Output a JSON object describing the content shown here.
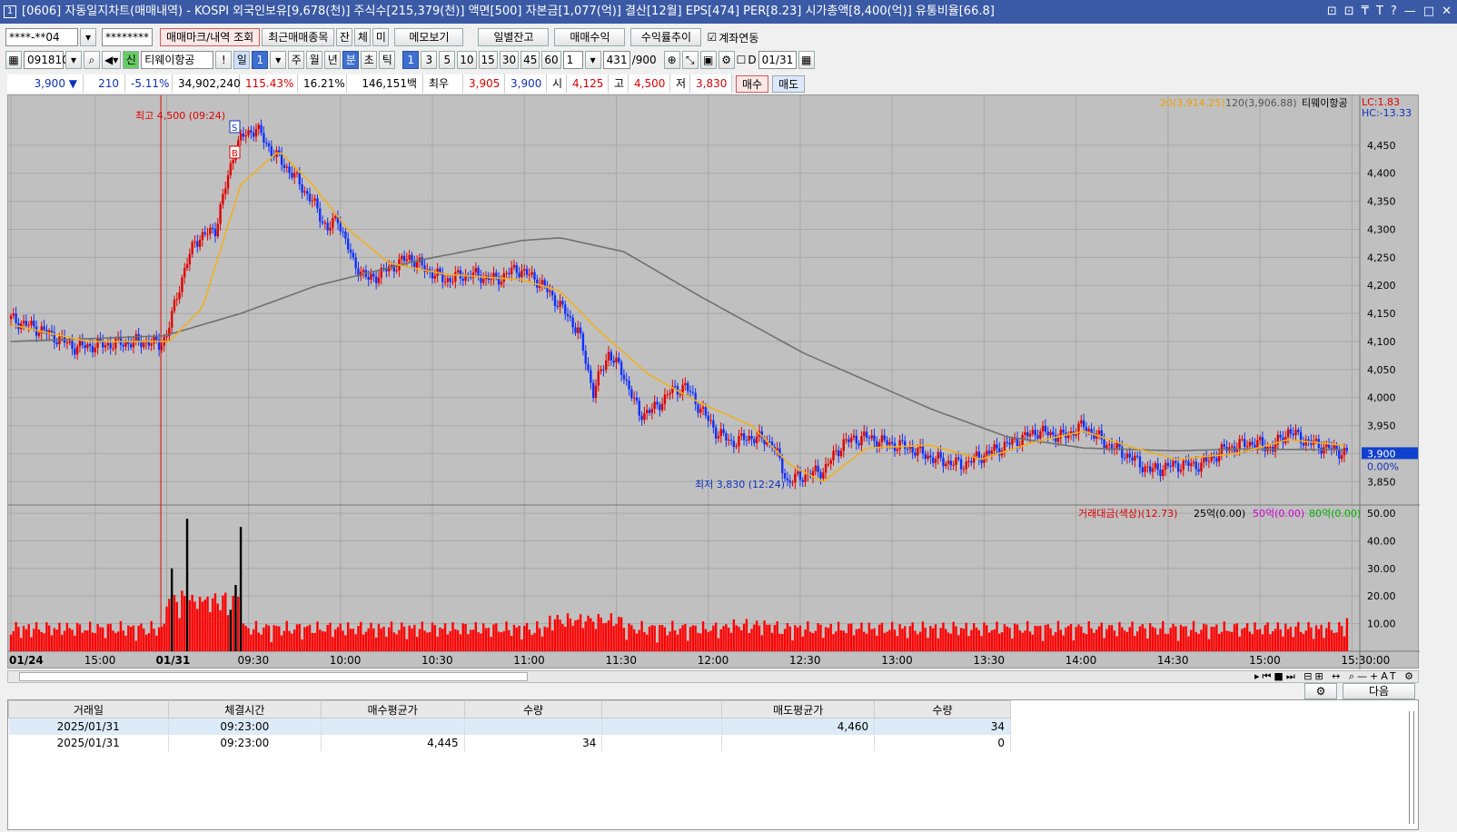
{
  "window": {
    "num": "1",
    "title": "[0606] 자동일지차트(매매내역) - KOSPI 외국인보유[9,678(천)] 주식수[215,379(천)] 액면[500] 자본금[1,077(억)] 결산[12월] EPS[474] PER[8.23] 시가총액[8,400(억)] 유통비율[66.8]",
    "controls": [
      "⊡",
      "⊡",
      "₸",
      "T",
      "?",
      "—",
      "□",
      "✕"
    ]
  },
  "toolbar1": {
    "account": "****-**04",
    "password": "********",
    "buttons": [
      "매매마크/내역 조회",
      "최근매매종목",
      "잔",
      "체",
      "미",
      "메모보기",
      "일별잔고",
      "매매수익",
      "수익률추이"
    ],
    "checkbox": "계좌연동"
  },
  "toolbar2": {
    "code": "091810",
    "stock": "티웨이항공",
    "periods": [
      "일",
      "1",
      "주",
      "월",
      "년",
      "분",
      "초",
      "틱",
      "1",
      "3",
      "5",
      "10",
      "15",
      "30",
      "45",
      "60"
    ],
    "unit": "1",
    "count": "431",
    "total": "/900",
    "date_label": "D",
    "date": "01/31"
  },
  "quote": {
    "price": "3,900 ▼",
    "change": "210",
    "rate": "-5.11%",
    "volume": "34,902,240",
    "ratio": "115.43%",
    "turnover": "16.21%",
    "amount": "146,151백만",
    "best_label": "최우선",
    "best_ask": "3,905",
    "best_bid": "3,900",
    "open_label": "시",
    "open": "4,125",
    "high_label": "고",
    "high": "4,500",
    "low_label": "저",
    "low": "3,830",
    "buy": "매수",
    "sell": "매도"
  },
  "chart_data": {
    "type": "line",
    "title": "티웨이항공",
    "legend": [
      "20(3,914.25)",
      "120(3,906.88)",
      "티웨이항공"
    ],
    "lc": "LC:1.83",
    "hc": "HC:-13.33",
    "max_label": "최고 4,500 (09:24)",
    "min_label": "최저 3,830 (12:24)",
    "current": "3,900",
    "current_pct": "0.00%",
    "y_ticks": [
      "4,450",
      "4,400",
      "4,350",
      "4,300",
      "4,250",
      "4,200",
      "4,150",
      "4,100",
      "4,050",
      "4,000",
      "3,950",
      "3,900",
      "3,850"
    ],
    "y_values": [
      4450,
      4400,
      4350,
      4300,
      4250,
      4200,
      4150,
      4100,
      4050,
      4000,
      3950,
      3900,
      3850
    ],
    "ylim": [
      3810,
      4500
    ],
    "vol_legend": [
      "거래대금(색상)(12.73)",
      "25억(0.00)",
      "50억(0.00)",
      "80억(0.00)"
    ],
    "vol_ticks": [
      "50.00",
      "40.00",
      "30.00",
      "20.00",
      "10.00"
    ],
    "vol_values": [
      50,
      40,
      30,
      20,
      10
    ],
    "x_ticks": [
      "01/24",
      "15:00",
      "01/31",
      "09:30",
      "10:00",
      "10:30",
      "11:00",
      "11:30",
      "12:00",
      "12:30",
      "13:00",
      "13:30",
      "14:00",
      "14:30",
      "15:00",
      "15:30:00"
    ],
    "x_idx": [
      0,
      33,
      61,
      93,
      129,
      165,
      201,
      237,
      273,
      309,
      345,
      381,
      417,
      453,
      489,
      525
    ],
    "n": 528,
    "price_keys": [
      [
        0,
        4140
      ],
      [
        12,
        4120
      ],
      [
        25,
        4090
      ],
      [
        38,
        4095
      ],
      [
        52,
        4100
      ],
      [
        58,
        4095
      ],
      [
        61,
        4110
      ],
      [
        66,
        4200
      ],
      [
        72,
        4280
      ],
      [
        80,
        4300
      ],
      [
        88,
        4450
      ],
      [
        92,
        4470
      ],
      [
        96,
        4480
      ],
      [
        102,
        4440
      ],
      [
        110,
        4400
      ],
      [
        118,
        4350
      ],
      [
        124,
        4300
      ],
      [
        128,
        4320
      ],
      [
        134,
        4240
      ],
      [
        140,
        4210
      ],
      [
        148,
        4230
      ],
      [
        156,
        4250
      ],
      [
        162,
        4230
      ],
      [
        170,
        4210
      ],
      [
        180,
        4220
      ],
      [
        190,
        4210
      ],
      [
        198,
        4230
      ],
      [
        206,
        4210
      ],
      [
        214,
        4170
      ],
      [
        222,
        4120
      ],
      [
        228,
        4010
      ],
      [
        234,
        4080
      ],
      [
        240,
        4040
      ],
      [
        246,
        3970
      ],
      [
        252,
        3980
      ],
      [
        258,
        4010
      ],
      [
        264,
        4020
      ],
      [
        270,
        3980
      ],
      [
        276,
        3940
      ],
      [
        282,
        3920
      ],
      [
        290,
        3930
      ],
      [
        298,
        3920
      ],
      [
        304,
        3850
      ],
      [
        310,
        3860
      ],
      [
        318,
        3870
      ],
      [
        326,
        3920
      ],
      [
        334,
        3930
      ],
      [
        342,
        3920
      ],
      [
        352,
        3910
      ],
      [
        362,
        3890
      ],
      [
        372,
        3880
      ],
      [
        382,
        3900
      ],
      [
        392,
        3920
      ],
      [
        402,
        3940
      ],
      [
        412,
        3930
      ],
      [
        420,
        3950
      ],
      [
        428,
        3920
      ],
      [
        436,
        3900
      ],
      [
        446,
        3870
      ],
      [
        456,
        3880
      ],
      [
        466,
        3880
      ],
      [
        476,
        3910
      ],
      [
        486,
        3920
      ],
      [
        494,
        3910
      ],
      [
        500,
        3940
      ],
      [
        508,
        3920
      ],
      [
        516,
        3910
      ],
      [
        523,
        3900
      ]
    ],
    "ma20_keys": [
      [
        0,
        4130
      ],
      [
        30,
        4100
      ],
      [
        62,
        4100
      ],
      [
        75,
        4160
      ],
      [
        90,
        4380
      ],
      [
        105,
        4440
      ],
      [
        118,
        4380
      ],
      [
        132,
        4300
      ],
      [
        148,
        4240
      ],
      [
        170,
        4220
      ],
      [
        200,
        4210
      ],
      [
        215,
        4190
      ],
      [
        230,
        4120
      ],
      [
        250,
        4040
      ],
      [
        270,
        3990
      ],
      [
        290,
        3950
      ],
      [
        305,
        3880
      ],
      [
        318,
        3850
      ],
      [
        335,
        3910
      ],
      [
        360,
        3915
      ],
      [
        380,
        3890
      ],
      [
        400,
        3920
      ],
      [
        420,
        3940
      ],
      [
        440,
        3910
      ],
      [
        456,
        3890
      ],
      [
        480,
        3900
      ],
      [
        500,
        3925
      ],
      [
        523,
        3914
      ]
    ],
    "ma120_keys": [
      [
        0,
        4100
      ],
      [
        60,
        4110
      ],
      [
        90,
        4150
      ],
      [
        120,
        4200
      ],
      [
        160,
        4245
      ],
      [
        200,
        4280
      ],
      [
        215,
        4285
      ],
      [
        240,
        4260
      ],
      [
        270,
        4180
      ],
      [
        310,
        4080
      ],
      [
        360,
        3980
      ],
      [
        390,
        3930
      ],
      [
        420,
        3910
      ],
      [
        456,
        3905
      ],
      [
        480,
        3908
      ],
      [
        523,
        3907
      ]
    ]
  },
  "trades": {
    "headers": [
      "거래일",
      "체결시간",
      "매수평균가",
      "수량",
      "",
      "매도평균가",
      "수량"
    ],
    "rows": [
      [
        "2025/01/31",
        "09:23:00",
        "",
        "",
        "",
        "4,460",
        "34"
      ],
      [
        "2025/01/31",
        "09:23:00",
        "4,445",
        "34",
        "",
        "",
        "0"
      ]
    ],
    "next": "다음"
  }
}
